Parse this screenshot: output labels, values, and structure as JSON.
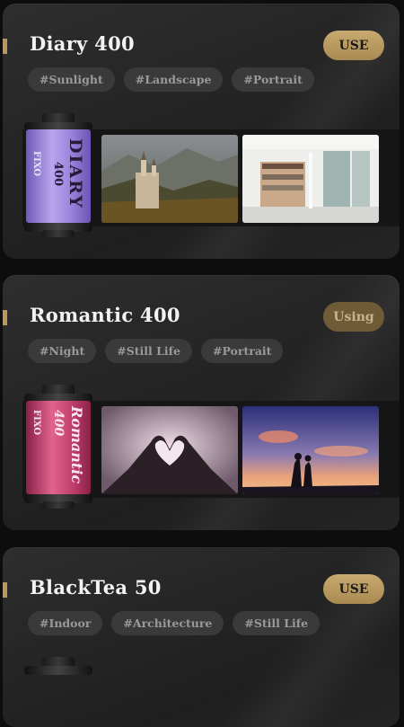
{
  "cards": [
    {
      "title": "Diary 400",
      "button": "USE",
      "tags": [
        "#Sunlight",
        "#Landscape",
        "#Portrait"
      ],
      "canister": {
        "brand": "DIARY",
        "iso": "400",
        "maker": "FIXO",
        "colors": [
          "#b59be0",
          "#8a74d0"
        ]
      }
    },
    {
      "title": "Romantic 400",
      "button": "Using",
      "tags": [
        "#Night",
        "#Still Life",
        "#Portrait"
      ],
      "canister": {
        "brand": "Romantic",
        "iso": "400",
        "maker": "FIXO",
        "colors": [
          "#d8567e",
          "#a9305a"
        ]
      }
    },
    {
      "title": "BlackTea 50",
      "button": "USE",
      "tags": [
        "#Indoor",
        "#Architecture",
        "#Still Life"
      ]
    }
  ],
  "colors": {
    "accent": "#b9985a",
    "use_button": "#c8ab70",
    "using_button": "#6f5c36"
  }
}
